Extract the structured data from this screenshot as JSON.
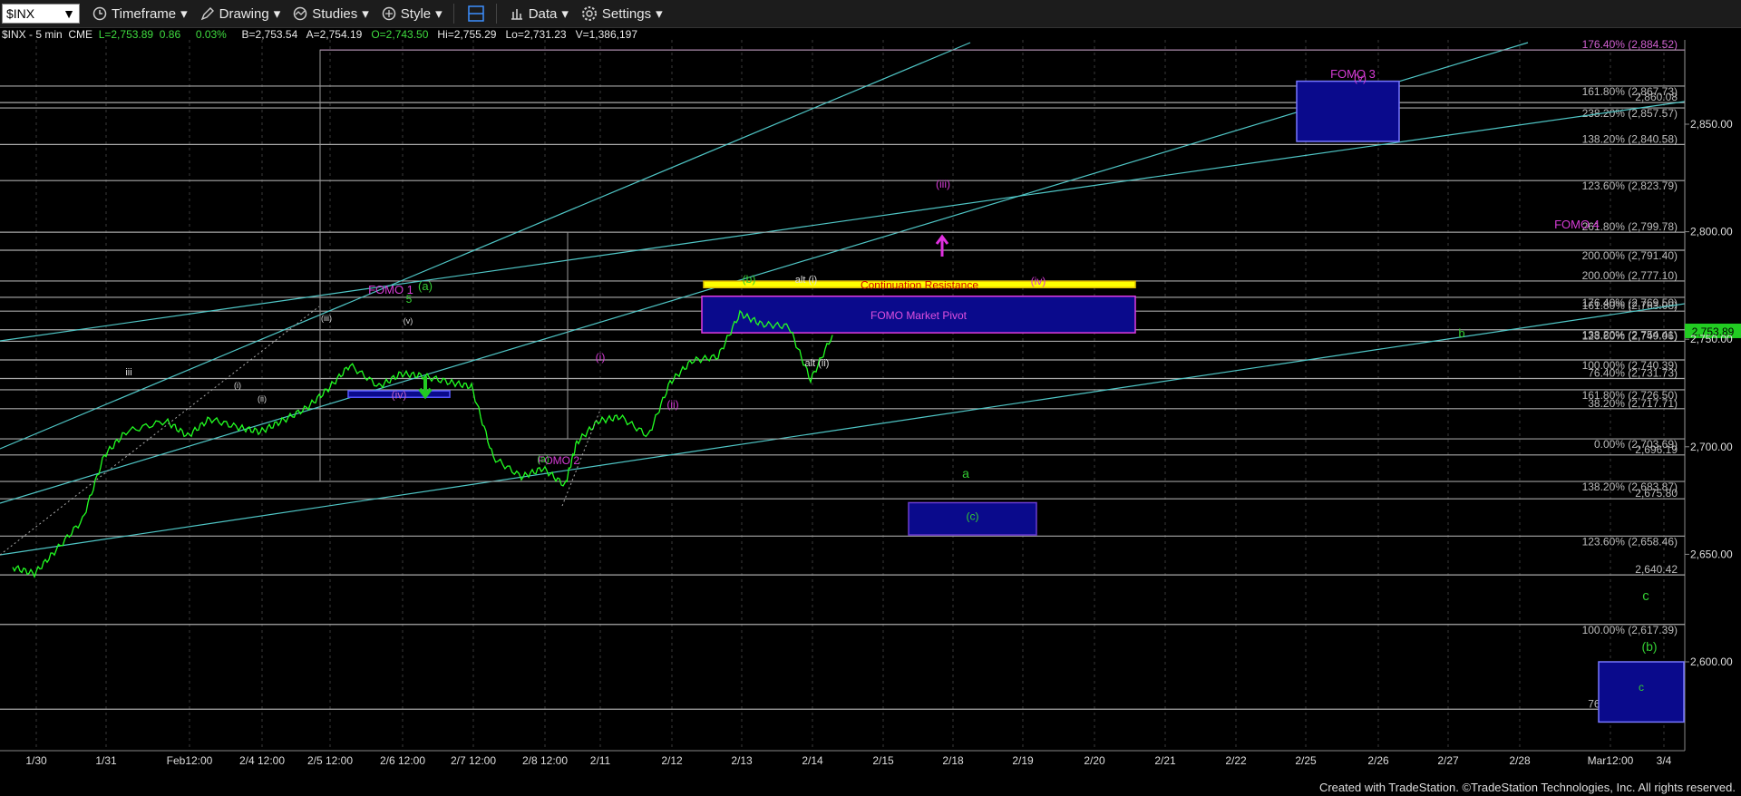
{
  "toolbar": {
    "symbol": "$INX",
    "items": [
      {
        "name": "timeframe",
        "label": "Timeframe"
      },
      {
        "name": "drawing",
        "label": "Drawing"
      },
      {
        "name": "studies",
        "label": "Studies"
      },
      {
        "name": "style",
        "label": "Style"
      },
      {
        "name": "data",
        "label": "Data"
      },
      {
        "name": "settings",
        "label": "Settings"
      }
    ]
  },
  "quote": {
    "symbol": "$INX - 5 min  CME",
    "last": "L=2,753.89",
    "change": "0.86",
    "change_pct": "0.03%",
    "bid": "B=2,753.54",
    "ask": "A=2,754.19",
    "open": "O=2,743.50",
    "high": "Hi=2,755.29",
    "low": "Lo=2,731.23",
    "volume": "V=1,386,197"
  },
  "credit": "Created with TradeStation. ©TradeStation Technologies, Inc. All rights reserved.",
  "colors": {
    "background": "#000000",
    "price": "#22ff22",
    "channel": "#4fc6c6",
    "fib_line": "#a9a9a9",
    "magenta": "#d63cd6",
    "zone_blue": "#0a0a8c",
    "yellow": "#ffff00",
    "green_label": "#33cc33"
  },
  "chart_data": {
    "type": "line",
    "title": "",
    "ylim": [
      2572,
      2888
    ],
    "y_ticks": [
      "2,850.00",
      "2,800.00",
      "2,750.00",
      "2,700.00",
      "2,650.00",
      "2,600.00"
    ],
    "y_tick_values": [
      2850,
      2800,
      2750,
      2700,
      2650,
      2600
    ],
    "x_ticks": [
      "1/30",
      "1/31",
      "Feb12:00",
      "2/4 12:00",
      "2/5 12:00",
      "2/6 12:00",
      "2/7 12:00",
      "2/8 12:00",
      "2/11",
      "2/12",
      "2/13",
      "2/14",
      "2/15",
      "2/18",
      "2/19",
      "2/20",
      "2/21",
      "2/22",
      "2/25",
      "2/26",
      "2/27",
      "2/28",
      "Mar12:00",
      "3/4"
    ],
    "last_price": "2,753.89",
    "series": [
      {
        "x": [
          "1/30",
          "1/30",
          "1/30",
          "1/31",
          "1/31",
          "1/31",
          "Feb12:00",
          "Feb12:00",
          "Feb12:00",
          "2/4 12:00",
          "2/4 12:00",
          "2/4 12:00",
          "2/5 12:00",
          "2/5 12:00",
          "2/5 12:00",
          "2/6 12:00",
          "2/6 12:00",
          "2/6 12:00",
          "2/7 12:00",
          "2/7 12:00",
          "2/7 12:00",
          "2/8 12:00",
          "2/8 12:00",
          "2/8 12:00",
          "2/11",
          "2/11",
          "2/11",
          "2/12",
          "2/12",
          "2/12",
          "2/13",
          "2/13",
          "2/13",
          "2/14",
          "2/14",
          "2/14"
        ],
        "values": [
          2644,
          2641,
          2652,
          2666,
          2696,
          2707,
          2712,
          2705,
          2713,
          2709,
          2707,
          2712,
          2718,
          2727,
          2738,
          2728,
          2734,
          2733,
          2730,
          2728,
          2695,
          2686,
          2690,
          2682,
          2702,
          2712,
          2714,
          2705,
          2730,
          2740,
          2742,
          2762,
          2757,
          2756,
          2731,
          2752
        ]
      }
    ],
    "horizontal_levels": [
      {
        "label": "176.40% (2,884.52)",
        "value": 2884.52,
        "color": "#c040c0"
      },
      {
        "label": "161.80% (2,867.73)",
        "value": 2867.73
      },
      {
        "label": "2,860.08",
        "value": 2860.08
      },
      {
        "label": "238.20% (2,857.57)",
        "value": 2857.57
      },
      {
        "label": "138.20% (2,840.58)",
        "value": 2840.58
      },
      {
        "label": "123.60% (2,823.79)",
        "value": 2823.79
      },
      {
        "label": "261.80% (2,799.78)",
        "value": 2799.78
      },
      {
        "label": "200.00% (2,791.40)",
        "value": 2791.4
      },
      {
        "label": "200.00% (2,777.10)",
        "value": 2777.1
      },
      {
        "label": "176.40% (2,769.50)",
        "value": 2769.5
      },
      {
        "label": "161.80% (2,763.08)",
        "value": 2763.08
      },
      {
        "label": "138.20% (2,754.41)",
        "value": 2754.41
      },
      {
        "label": "123.60% (2,749.06)",
        "value": 2749.06
      },
      {
        "label": "100.00% (2,740.39)",
        "value": 2740.39
      },
      {
        "label": "76.40% (2,731.73)",
        "value": 2731.73
      },
      {
        "label": "161.80% (2,726.50)",
        "value": 2726.5
      },
      {
        "label": "38.20% (2,717.71)",
        "value": 2717.71
      },
      {
        "label": "0.00% (2,703.69)",
        "value": 2703.69
      },
      {
        "label": "2,696.19",
        "value": 2696.19
      },
      {
        "label": "138.20% (2,683.87)",
        "value": 2683.87
      },
      {
        "label": "2,675.80",
        "value": 2675.8
      },
      {
        "label": "123.60% (2,658.46)",
        "value": 2658.46
      },
      {
        "label": "2,640.42",
        "value": 2640.42
      },
      {
        "label": "100.00% (2,617.39)",
        "value": 2617.39
      },
      {
        "label": "76.40% (2,577.96)",
        "value": 2577.96
      }
    ],
    "zones": [
      {
        "label": "FOMO 1",
        "sublabel": "(iv)",
        "x0": "2/5 12:00",
        "x1": "2/6 12:00",
        "y0": 2723,
        "y1": 2726
      },
      {
        "label": "Continuation Resistance",
        "x0": "2/12",
        "x1": "2/20",
        "y0": 2774,
        "y1": 2777
      },
      {
        "label": "FOMO Market Pivot",
        "x0": "2/12",
        "x1": "2/20",
        "y0": 2753,
        "y1": 2770
      },
      {
        "label": "(c)",
        "x0": "2/15",
        "x1": "2/18",
        "y0": 2659,
        "y1": 2674
      },
      {
        "label": "FOMO 3",
        "x0": "2/25",
        "x1": "2/26",
        "y0": 2842,
        "y1": 2870
      },
      {
        "label": "c",
        "x0": "Mar12:00",
        "x1": "3/4",
        "y0": 2572,
        "y1": 2600
      }
    ],
    "annotations": [
      "FOMO 1",
      "FOMO 2",
      "FOMO 3",
      "FOMO 4",
      "Continuation Resistance",
      "FOMO Market Pivot",
      "(a)",
      "(a)",
      "5",
      "(iii)",
      "(iv)",
      "(v)",
      "iii",
      "(i)",
      "(ii)",
      "(i)",
      "(ii)",
      "(b)",
      "alt (i)",
      "alt (ii)",
      "(iii)",
      "(iv)",
      "(v)",
      "(c)",
      "a",
      "b",
      "c",
      "(b)"
    ]
  }
}
